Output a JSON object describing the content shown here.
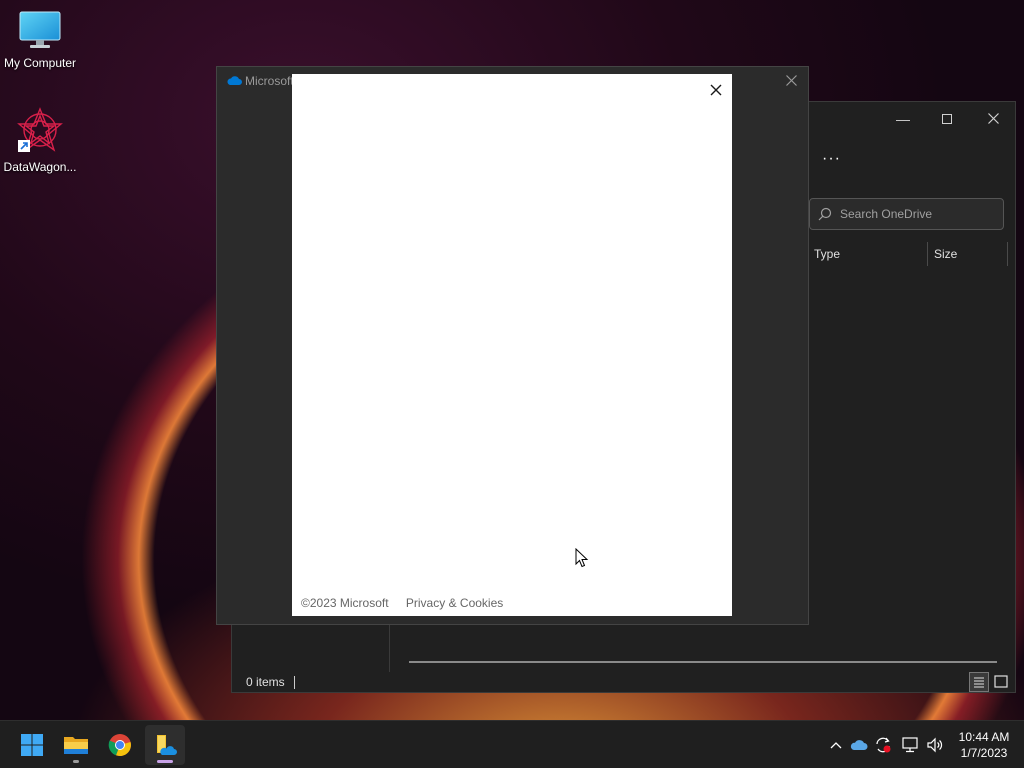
{
  "desktop": {
    "icons": [
      {
        "label": "My Computer"
      },
      {
        "label": "DataWagon..."
      }
    ]
  },
  "explorer": {
    "more_label": "···",
    "search_placeholder": "Search OneDrive",
    "columns": [
      "Type",
      "Size"
    ],
    "status": "0 items"
  },
  "onedrive_dialog": {
    "title": "Microsoft",
    "footer": {
      "copyright": "©2023 Microsoft",
      "privacy": "Privacy & Cookies"
    }
  },
  "taskbar": {
    "apps": [
      "start",
      "file-explorer",
      "chrome",
      "onedrive-setup"
    ],
    "clock": {
      "time": "10:44 AM",
      "date": "1/7/2023"
    }
  },
  "colors": {
    "accent": "#0078d4",
    "taskbar": "#1f1f1f",
    "window": "#202020",
    "dialog_panel": "#ffffff"
  }
}
